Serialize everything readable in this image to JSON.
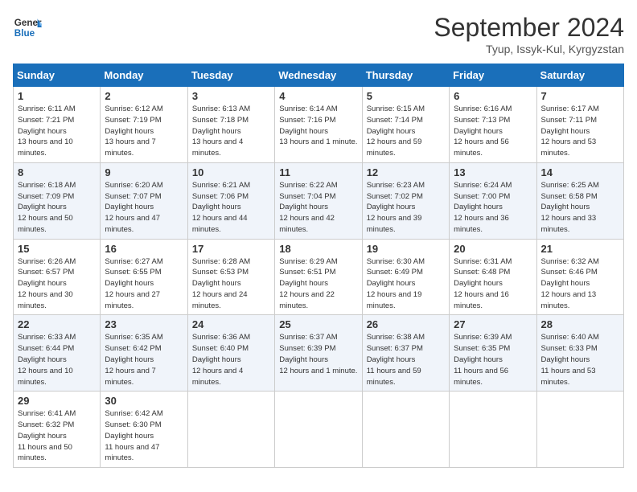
{
  "logo": {
    "general": "General",
    "blue": "Blue"
  },
  "header": {
    "month": "September 2024",
    "location": "Tyup, Issyk-Kul, Kyrgyzstan"
  },
  "weekdays": [
    "Sunday",
    "Monday",
    "Tuesday",
    "Wednesday",
    "Thursday",
    "Friday",
    "Saturday"
  ],
  "weeks": [
    [
      {
        "day": "1",
        "sunrise": "6:11 AM",
        "sunset": "7:21 PM",
        "daylight": "13 hours and 10 minutes."
      },
      {
        "day": "2",
        "sunrise": "6:12 AM",
        "sunset": "7:19 PM",
        "daylight": "13 hours and 7 minutes."
      },
      {
        "day": "3",
        "sunrise": "6:13 AM",
        "sunset": "7:18 PM",
        "daylight": "13 hours and 4 minutes."
      },
      {
        "day": "4",
        "sunrise": "6:14 AM",
        "sunset": "7:16 PM",
        "daylight": "13 hours and 1 minute."
      },
      {
        "day": "5",
        "sunrise": "6:15 AM",
        "sunset": "7:14 PM",
        "daylight": "12 hours and 59 minutes."
      },
      {
        "day": "6",
        "sunrise": "6:16 AM",
        "sunset": "7:13 PM",
        "daylight": "12 hours and 56 minutes."
      },
      {
        "day": "7",
        "sunrise": "6:17 AM",
        "sunset": "7:11 PM",
        "daylight": "12 hours and 53 minutes."
      }
    ],
    [
      {
        "day": "8",
        "sunrise": "6:18 AM",
        "sunset": "7:09 PM",
        "daylight": "12 hours and 50 minutes."
      },
      {
        "day": "9",
        "sunrise": "6:20 AM",
        "sunset": "7:07 PM",
        "daylight": "12 hours and 47 minutes."
      },
      {
        "day": "10",
        "sunrise": "6:21 AM",
        "sunset": "7:06 PM",
        "daylight": "12 hours and 44 minutes."
      },
      {
        "day": "11",
        "sunrise": "6:22 AM",
        "sunset": "7:04 PM",
        "daylight": "12 hours and 42 minutes."
      },
      {
        "day": "12",
        "sunrise": "6:23 AM",
        "sunset": "7:02 PM",
        "daylight": "12 hours and 39 minutes."
      },
      {
        "day": "13",
        "sunrise": "6:24 AM",
        "sunset": "7:00 PM",
        "daylight": "12 hours and 36 minutes."
      },
      {
        "day": "14",
        "sunrise": "6:25 AM",
        "sunset": "6:58 PM",
        "daylight": "12 hours and 33 minutes."
      }
    ],
    [
      {
        "day": "15",
        "sunrise": "6:26 AM",
        "sunset": "6:57 PM",
        "daylight": "12 hours and 30 minutes."
      },
      {
        "day": "16",
        "sunrise": "6:27 AM",
        "sunset": "6:55 PM",
        "daylight": "12 hours and 27 minutes."
      },
      {
        "day": "17",
        "sunrise": "6:28 AM",
        "sunset": "6:53 PM",
        "daylight": "12 hours and 24 minutes."
      },
      {
        "day": "18",
        "sunrise": "6:29 AM",
        "sunset": "6:51 PM",
        "daylight": "12 hours and 22 minutes."
      },
      {
        "day": "19",
        "sunrise": "6:30 AM",
        "sunset": "6:49 PM",
        "daylight": "12 hours and 19 minutes."
      },
      {
        "day": "20",
        "sunrise": "6:31 AM",
        "sunset": "6:48 PM",
        "daylight": "12 hours and 16 minutes."
      },
      {
        "day": "21",
        "sunrise": "6:32 AM",
        "sunset": "6:46 PM",
        "daylight": "12 hours and 13 minutes."
      }
    ],
    [
      {
        "day": "22",
        "sunrise": "6:33 AM",
        "sunset": "6:44 PM",
        "daylight": "12 hours and 10 minutes."
      },
      {
        "day": "23",
        "sunrise": "6:35 AM",
        "sunset": "6:42 PM",
        "daylight": "12 hours and 7 minutes."
      },
      {
        "day": "24",
        "sunrise": "6:36 AM",
        "sunset": "6:40 PM",
        "daylight": "12 hours and 4 minutes."
      },
      {
        "day": "25",
        "sunrise": "6:37 AM",
        "sunset": "6:39 PM",
        "daylight": "12 hours and 1 minute."
      },
      {
        "day": "26",
        "sunrise": "6:38 AM",
        "sunset": "6:37 PM",
        "daylight": "11 hours and 59 minutes."
      },
      {
        "day": "27",
        "sunrise": "6:39 AM",
        "sunset": "6:35 PM",
        "daylight": "11 hours and 56 minutes."
      },
      {
        "day": "28",
        "sunrise": "6:40 AM",
        "sunset": "6:33 PM",
        "daylight": "11 hours and 53 minutes."
      }
    ],
    [
      {
        "day": "29",
        "sunrise": "6:41 AM",
        "sunset": "6:32 PM",
        "daylight": "11 hours and 50 minutes."
      },
      {
        "day": "30",
        "sunrise": "6:42 AM",
        "sunset": "6:30 PM",
        "daylight": "11 hours and 47 minutes."
      },
      null,
      null,
      null,
      null,
      null
    ]
  ],
  "labels": {
    "sunrise": "Sunrise:",
    "sunset": "Sunset:",
    "daylight": "Daylight hours"
  }
}
